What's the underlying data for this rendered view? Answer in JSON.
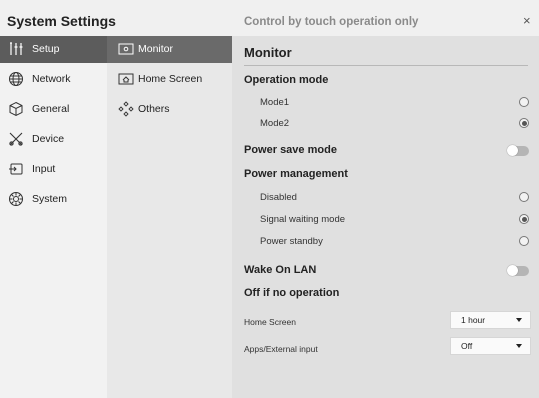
{
  "window": {
    "title": "System Settings",
    "notice": "Control by touch operation only",
    "close_glyph": "×"
  },
  "nav": {
    "primary": [
      {
        "label": "Setup",
        "icon": "tools-icon",
        "selected": true
      },
      {
        "label": "Network",
        "icon": "globe-icon",
        "selected": false
      },
      {
        "label": "General",
        "icon": "cube-icon",
        "selected": false
      },
      {
        "label": "Device",
        "icon": "device-tools-icon",
        "selected": false
      },
      {
        "label": "Input",
        "icon": "input-icon",
        "selected": false
      },
      {
        "label": "System",
        "icon": "gear-icon",
        "selected": false
      }
    ],
    "secondary": [
      {
        "label": "Monitor",
        "icon": "monitor-icon",
        "selected": true
      },
      {
        "label": "Home Screen",
        "icon": "home-icon",
        "selected": false
      },
      {
        "label": "Others",
        "icon": "others-icon",
        "selected": false
      }
    ]
  },
  "main": {
    "title": "Monitor",
    "operation_mode": {
      "label": "Operation mode",
      "options": [
        {
          "label": "Mode1",
          "selected": false
        },
        {
          "label": "Mode2",
          "selected": true
        }
      ]
    },
    "power_save_mode": {
      "label": "Power save mode",
      "enabled": false
    },
    "power_management": {
      "label": "Power management",
      "options": [
        {
          "label": "Disabled",
          "selected": false
        },
        {
          "label": "Signal waiting mode",
          "selected": true
        },
        {
          "label": "Power standby",
          "selected": false
        }
      ]
    },
    "wake_on_lan": {
      "label": "Wake On LAN",
      "enabled": false
    },
    "off_if_no_operation": {
      "label": "Off if no operation",
      "rows": [
        {
          "label": "Home Screen",
          "value": "1 hour"
        },
        {
          "label": "Apps/External input",
          "value": "Off"
        }
      ]
    }
  },
  "colors": {
    "selected_primary": "#5c5c5c",
    "selected_secondary": "#6a6a6a",
    "main_background": "#e0e0e0"
  }
}
